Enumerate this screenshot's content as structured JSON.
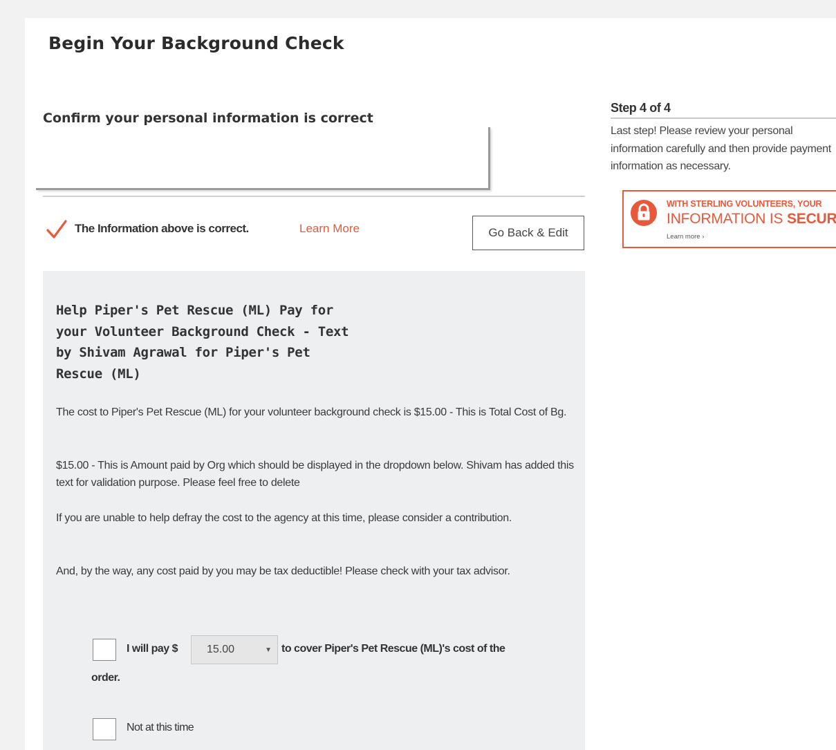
{
  "page": {
    "title": "Begin Your Background Check"
  },
  "confirm": {
    "heading": "Confirm your personal information is correct",
    "checkbox_label": "The Information above is correct.",
    "checked": true,
    "learn_more": "Learn More",
    "go_back_button": "Go Back & Edit"
  },
  "payment": {
    "title": "Help Piper's Pet Rescue (ML) Pay for your Volunteer Background Check - Text by Shivam Agrawal for Piper's Pet Rescue (ML)",
    "paragraphs": [
      "The cost to Piper's Pet Rescue (ML) for your volunteer background check is $15.00 - This is Total Cost of Bg.",
      "$15.00 - This is Amount paid by Org which should be displayed in the dropdown below. Shivam has added this text for validation purpose. Please feel free to delete",
      "If you are unable to help defray the cost to the agency at this time, please consider a contribution.",
      "And, by the way, any cost paid by you may be tax deductible! Please check with your tax advisor."
    ],
    "pay_prefix": "I will pay $",
    "pay_amount": "15.00",
    "pay_suffix": "to cover Piper's Pet Rescue (ML)'s cost of the",
    "pay_suffix_wrap": "order.",
    "not_at_this_time": "Not at this time"
  },
  "sidebar": {
    "step": "Step 4 of 4",
    "description": "Last step! Please review your personal information carefully and then provide payment information as necessary.",
    "secure_line1": "WITH STERLING VOLUNTEERS, YOUR",
    "secure_line2_prefix": "INFORMATION IS ",
    "secure_line2_strong": "SECURE",
    "secure_learn_more": "Learn more ›"
  },
  "colors": {
    "accent": "#e8583a",
    "panel_bg": "#eeeff1"
  },
  "icons": {
    "checkmark": "checkmark-icon",
    "lock": "lock-icon",
    "dropdown": "chevron-down-icon"
  }
}
